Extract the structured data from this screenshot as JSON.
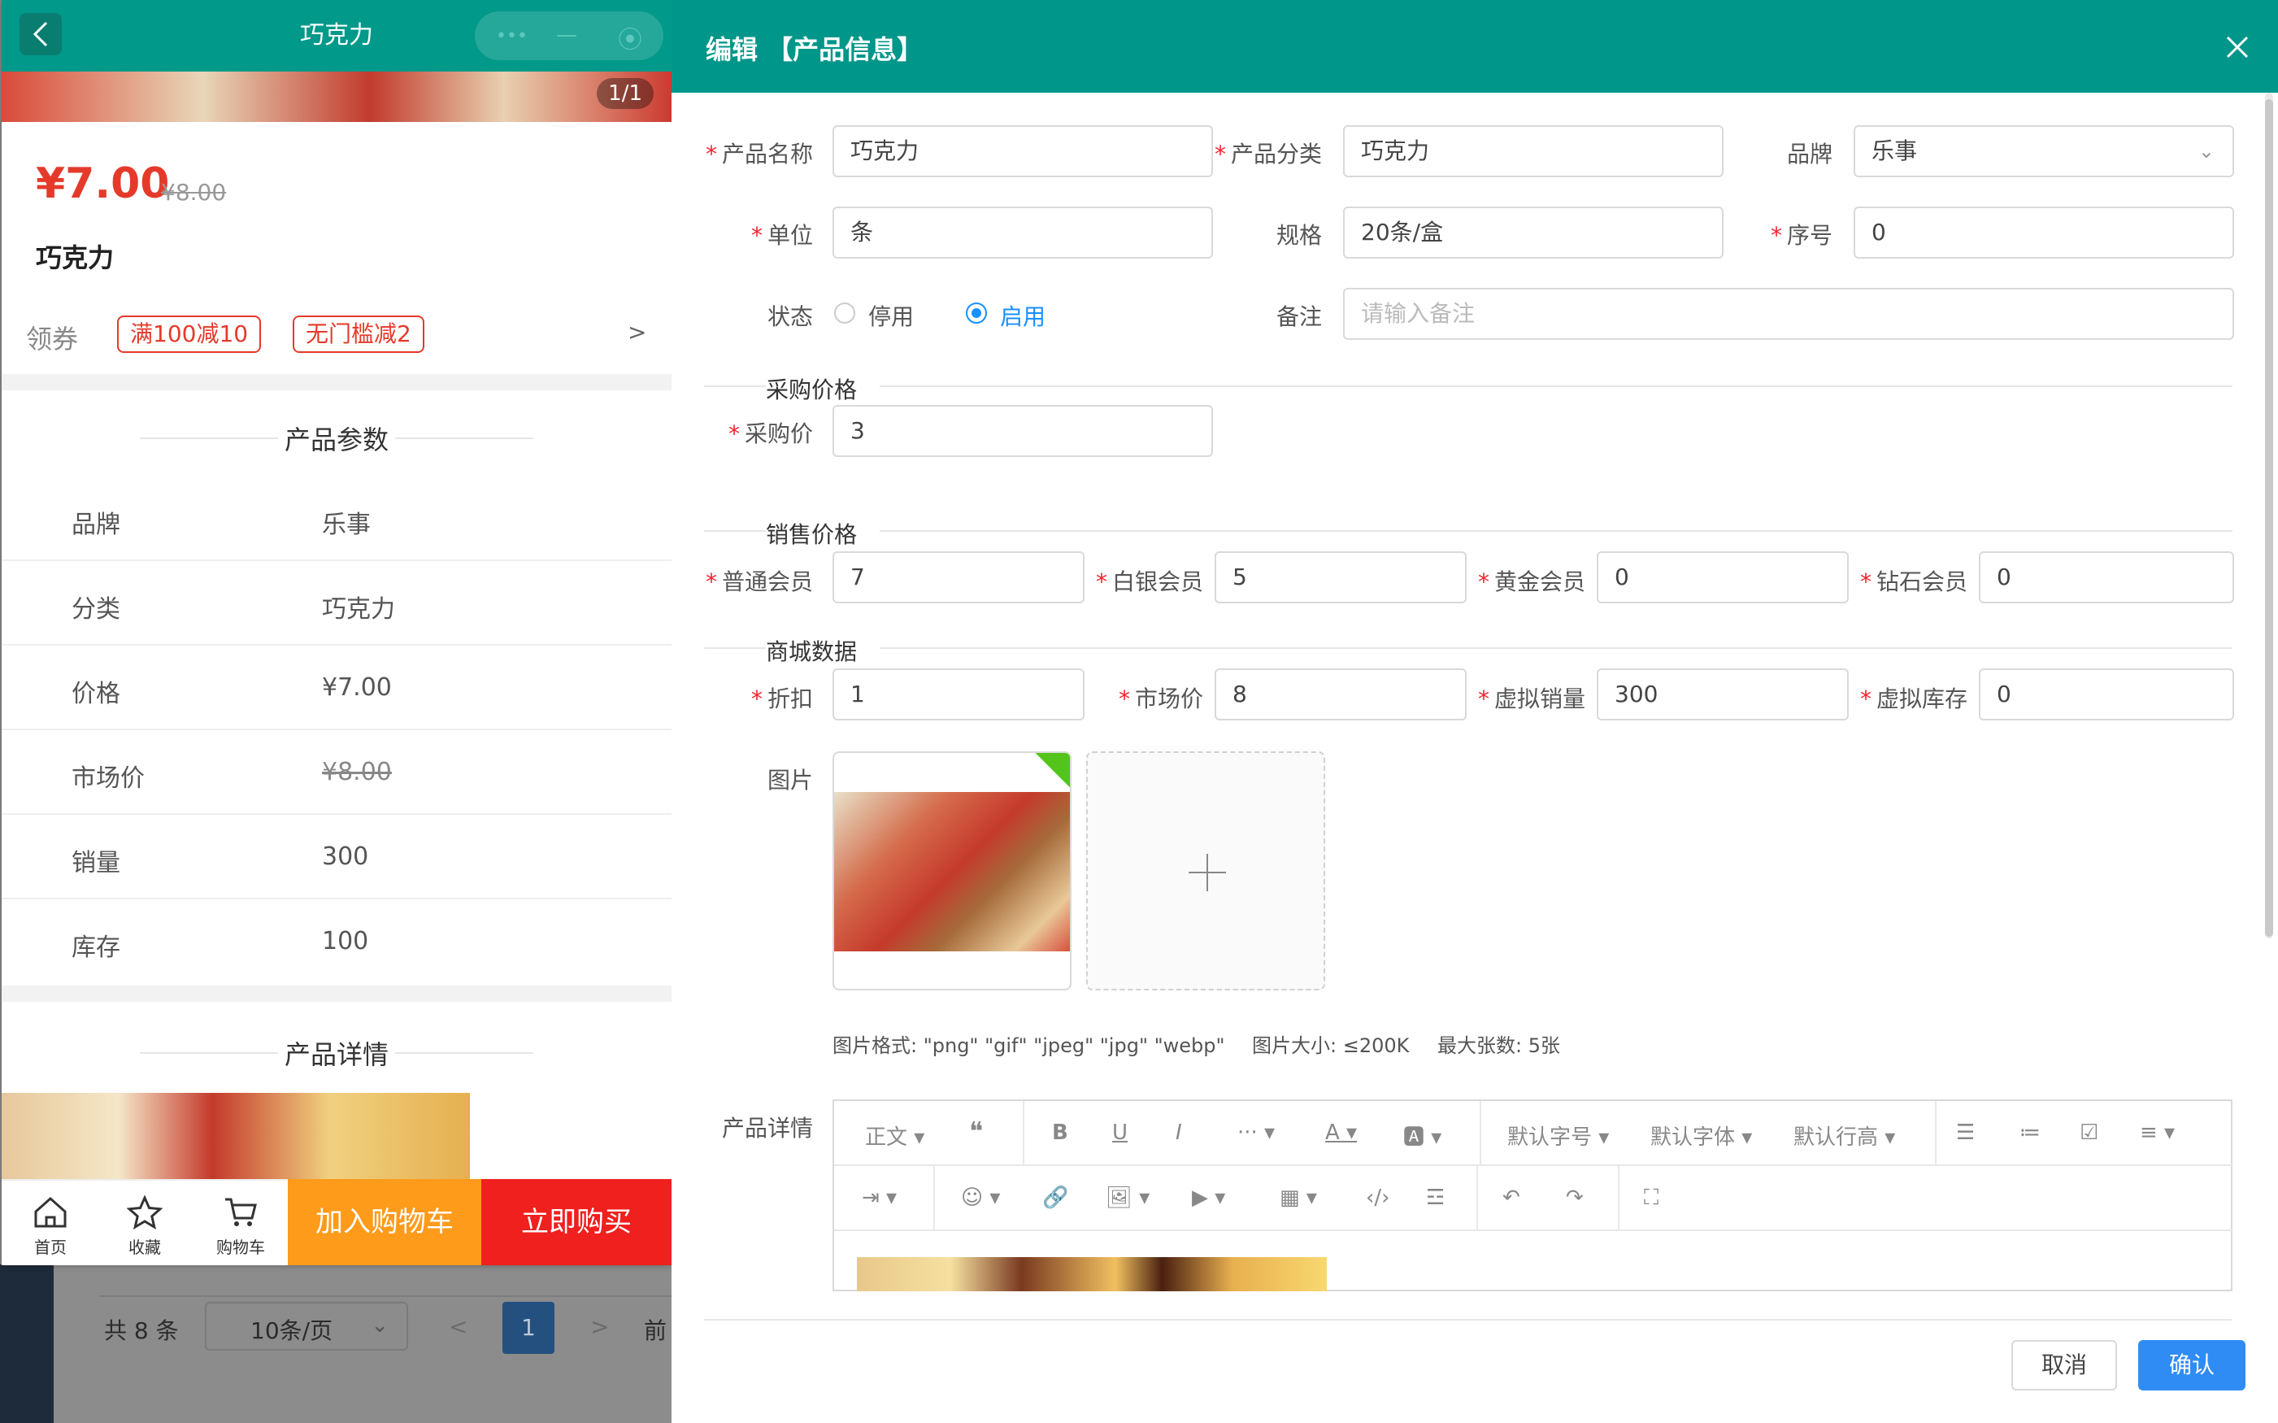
{
  "background": {
    "pager": {
      "total": "共 8 条",
      "page_size": "10条/页",
      "prev": "<",
      "current_page": "1",
      "next": ">",
      "jump": "前"
    }
  },
  "preview": {
    "header_title": "巧克力",
    "page_indicator": "1/1",
    "price": "¥7.00",
    "old_price": "¥8.00",
    "product_name": "巧克力",
    "coupon_label": "领券",
    "coupons": [
      "满100减10",
      "无门槛减2"
    ],
    "coupon_more": ">",
    "params_title": "产品参数",
    "params": [
      {
        "key": "品牌",
        "value": "乐事"
      },
      {
        "key": "分类",
        "value": "巧克力"
      },
      {
        "key": "价格",
        "value": "¥7.00"
      },
      {
        "key": "市场价",
        "value": "¥8.00"
      },
      {
        "key": "销量",
        "value": "300"
      },
      {
        "key": "库存",
        "value": "100"
      }
    ],
    "detail_title": "产品详情",
    "tabbar": {
      "home": "首页",
      "favorite": "收藏",
      "cart": "购物车",
      "add_to_cart": "加入购物车",
      "buy_now": "立即购买"
    },
    "colors": {
      "header": "#00998a",
      "price": "#e53a2a",
      "cart_button": "#ff9b1a",
      "buy_button": "#f0201e"
    }
  },
  "drawer": {
    "title": "编辑 【产品信息】",
    "fields": {
      "name": {
        "label": "产品名称",
        "value": "巧克力"
      },
      "category": {
        "label": "产品分类",
        "value": "巧克力"
      },
      "brand": {
        "label": "品牌",
        "value": "乐事"
      },
      "unit": {
        "label": "单位",
        "value": "条"
      },
      "spec": {
        "label": "规格",
        "value": "20条/盒"
      },
      "order": {
        "label": "序号",
        "value": "0"
      },
      "status": {
        "label": "状态",
        "option_off": "停用",
        "option_on": "启用",
        "selected": "启用"
      },
      "remark": {
        "label": "备注",
        "placeholder": "请输入备注"
      }
    },
    "purchase": {
      "section": "采购价格",
      "price": {
        "label": "采购价",
        "value": "3"
      }
    },
    "sale": {
      "section": "销售价格",
      "normal": {
        "label": "普通会员",
        "value": "7"
      },
      "silver": {
        "label": "白银会员",
        "value": "5"
      },
      "gold": {
        "label": "黄金会员",
        "value": "0"
      },
      "diamond": {
        "label": "钻石会员",
        "value": "0"
      }
    },
    "mall": {
      "section": "商城数据",
      "discount": {
        "label": "折扣",
        "value": "1"
      },
      "market_price": {
        "label": "市场价",
        "value": "8"
      },
      "virtual_sales": {
        "label": "虚拟销量",
        "value": "300"
      },
      "virtual_stock": {
        "label": "虚拟库存",
        "value": "0"
      }
    },
    "image": {
      "label": "图片",
      "hint_format": "图片格式: \"png\" \"gif\" \"jpeg\" \"jpg\" \"webp\"",
      "hint_size": "图片大小: ≤200K",
      "hint_count": "最大张数: 5张"
    },
    "detail": {
      "label": "产品详情",
      "toolbar": {
        "paragraph": "正文",
        "font_size": "默认字号",
        "font_family": "默认字体",
        "line_height": "默认行高"
      }
    },
    "buttons": {
      "cancel": "取消",
      "confirm": "确认"
    },
    "colors": {
      "header": "#00968a",
      "required": "#f5222d",
      "primary": "#2f8cf5",
      "radio_on": "#1890ff"
    }
  }
}
